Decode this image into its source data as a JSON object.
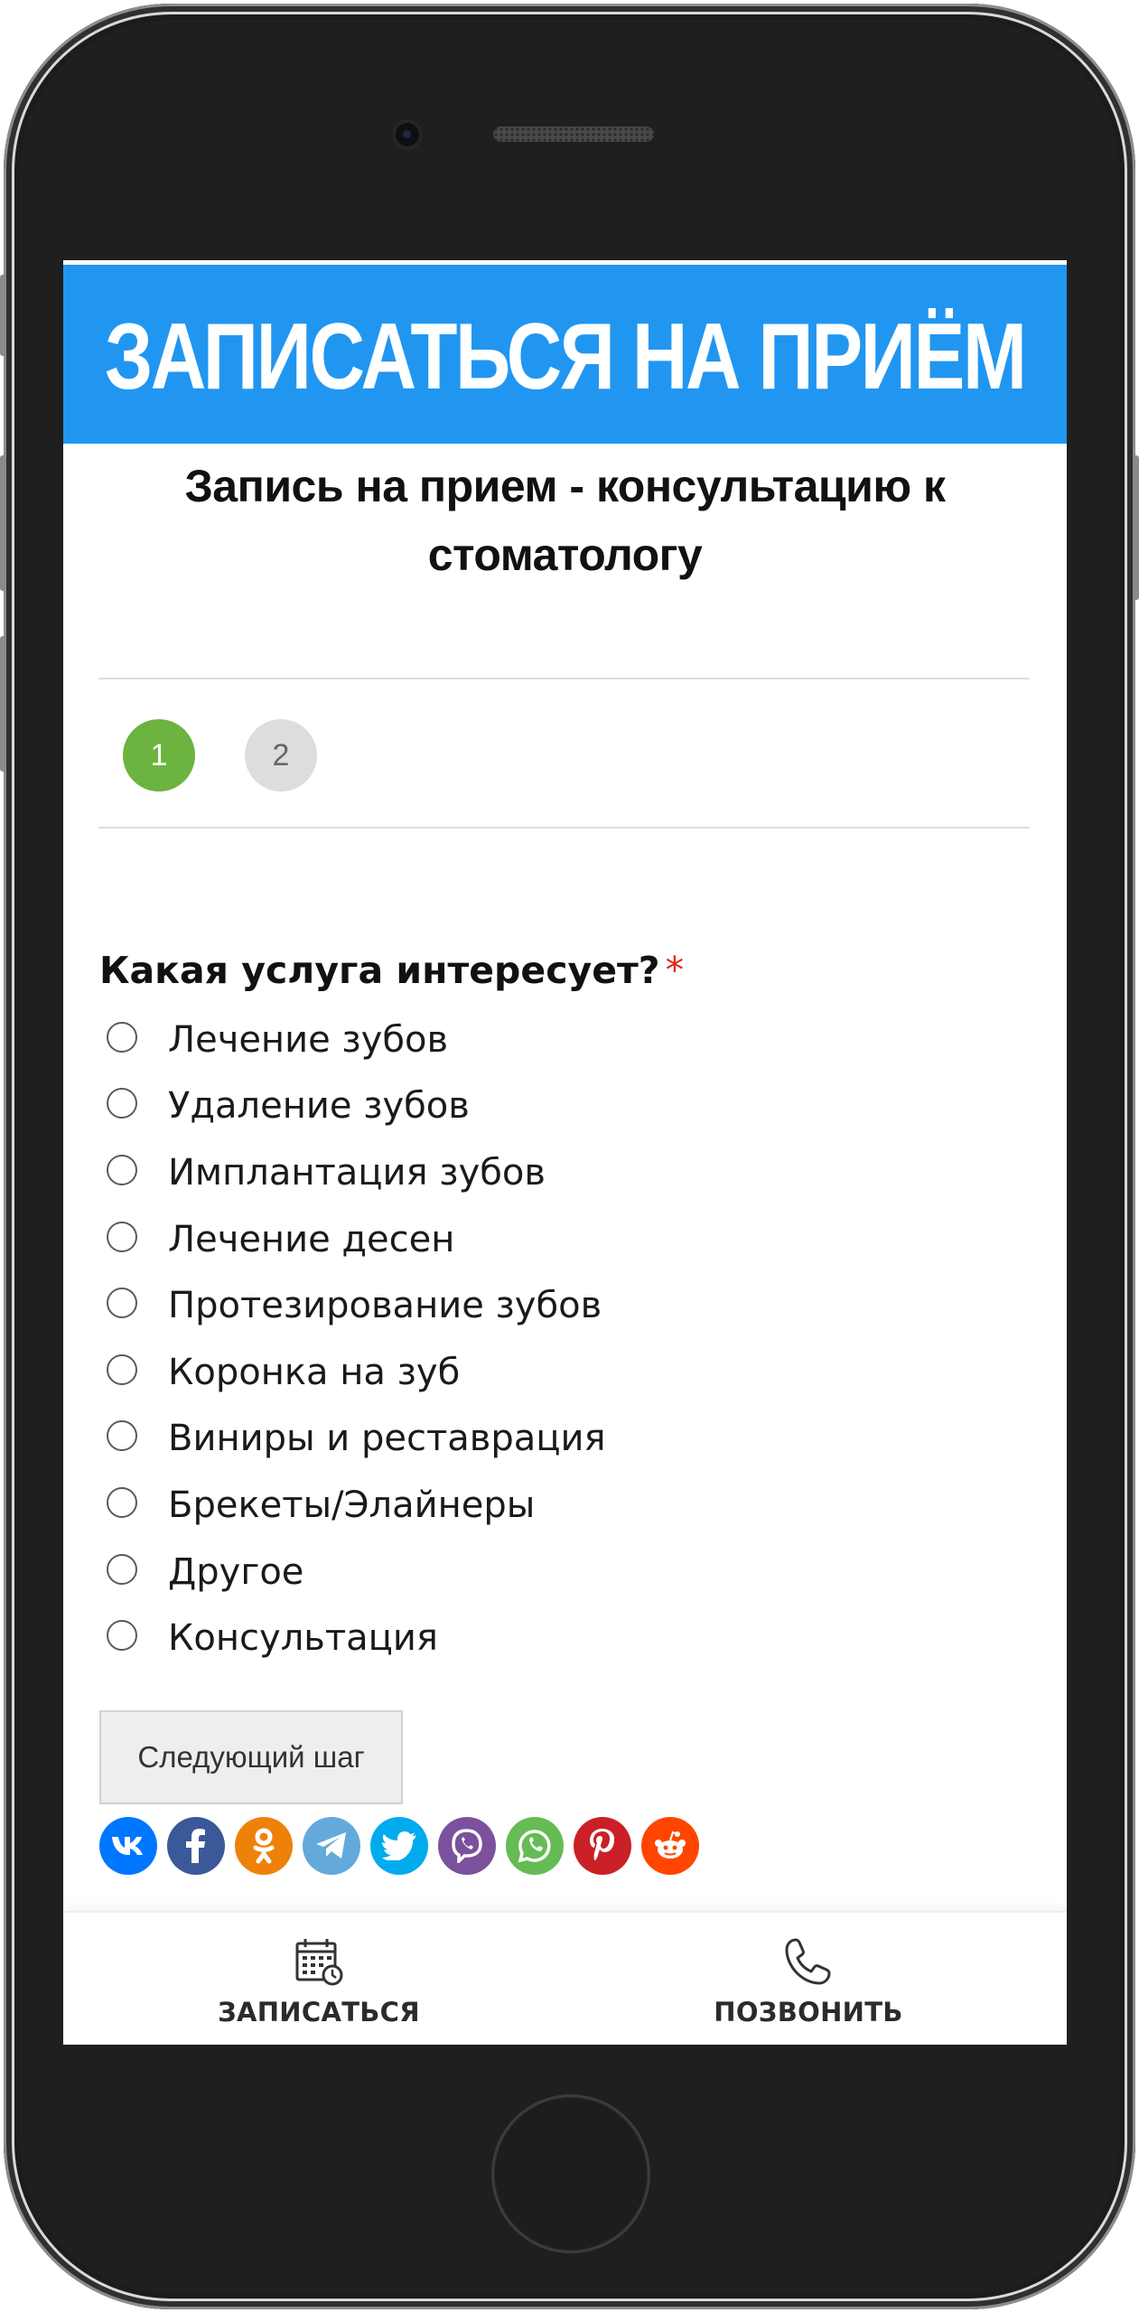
{
  "header": {
    "title": "ЗАПИСАТЬСЯ НА ПРИЁМ",
    "subtitle": "Запись на прием - консультацию к стоматологу"
  },
  "steps": [
    {
      "label": "1",
      "active": true
    },
    {
      "label": "2",
      "active": false
    }
  ],
  "form": {
    "question": "Какая услуга интересует?",
    "required_mark": "*",
    "options": [
      "Лечение зубов",
      "Удаление зубов",
      "Имплантация зубов",
      "Лечение десен",
      "Протезирование зубов",
      "Коронка на зуб",
      "Виниры и реставрация",
      "Брекеты/Элайнеры",
      "Другое",
      "Консультация"
    ],
    "next_button": "Следующий шаг"
  },
  "share_icons": [
    {
      "name": "vk-icon",
      "glyph": "vk",
      "color": "#0077ff"
    },
    {
      "name": "facebook-icon",
      "glyph": "f",
      "color": "#3b5998"
    },
    {
      "name": "odnoklassniki-icon",
      "glyph": "ok",
      "color": "#ee8208"
    },
    {
      "name": "telegram-icon",
      "glyph": "tg",
      "color": "#64a9dc"
    },
    {
      "name": "twitter-icon",
      "glyph": "tw",
      "color": "#00aced"
    },
    {
      "name": "viber-icon",
      "glyph": "vb",
      "color": "#7b519d"
    },
    {
      "name": "whatsapp-icon",
      "glyph": "wa",
      "color": "#65bc54"
    },
    {
      "name": "pinterest-icon",
      "glyph": "p",
      "color": "#cb2027"
    },
    {
      "name": "reddit-icon",
      "glyph": "rd",
      "color": "#ff4500"
    }
  ],
  "bottom_nav": {
    "book_label": "ЗАПИСАТЬСЯ",
    "call_label": "ПОЗВОНИТЬ",
    "book_icon": "calendar-icon",
    "call_icon": "phone-icon"
  },
  "colors": {
    "banner": "#2196f1",
    "step_active": "#6db33f",
    "step_inactive": "#dddddd",
    "required": "#e0291f"
  }
}
